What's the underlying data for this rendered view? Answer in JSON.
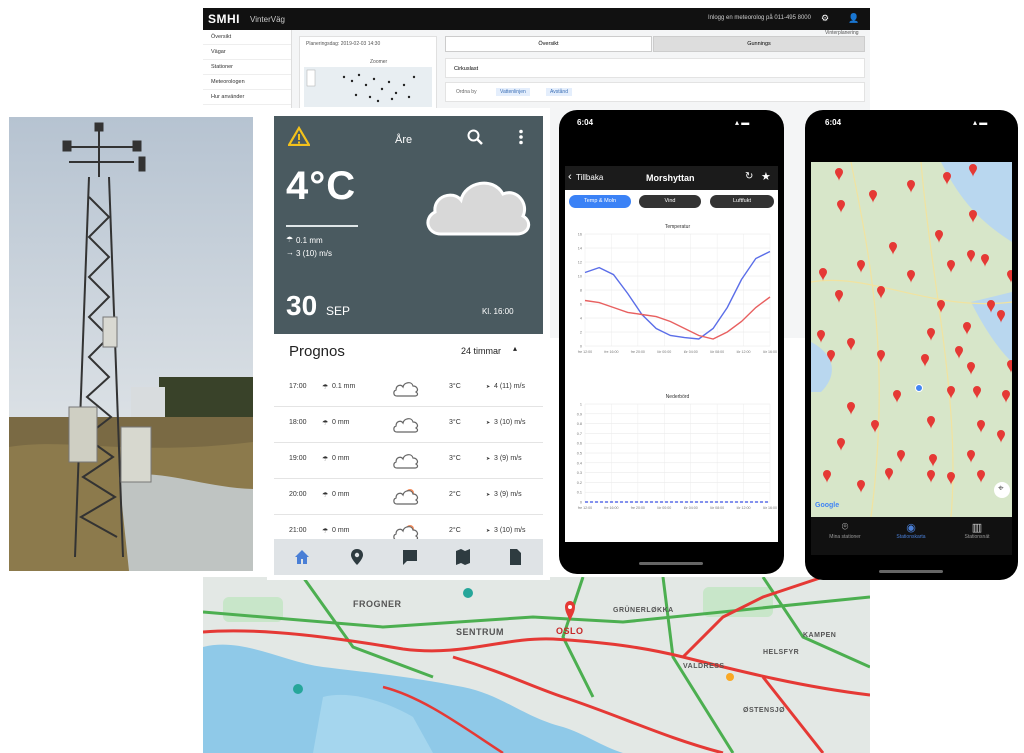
{
  "web": {
    "logo": "SMHI",
    "app_name": "VinterVäg",
    "top_right": "Inlogg en meteorolog på 011-495 8000",
    "sidebar": [
      "Översikt",
      "Vägar",
      "Stationer",
      "Meteorologen",
      "Hur använder"
    ],
    "panel_date": "Planeringsdag: 2019-02-03 14:30",
    "panel_zoom": "Zoomer",
    "tab_left": "Översikt",
    "tab_right": "Gunnings",
    "section": "Cirkuslast",
    "filter_label": "Ordna by",
    "chip_one": "Vattenlinjen",
    "chip_two": "Avstånd",
    "corner_right": "Vinterplanering"
  },
  "android": {
    "location": "Åre",
    "temperature": "4°C",
    "precip": "0.1 mm",
    "wind": "3 (10) m/s",
    "date_day": "30",
    "date_month": "SEP",
    "time": "Kl. 16:00",
    "prognos_title": "Prognos",
    "period": "24 timmar",
    "rows": [
      {
        "time": "17:00",
        "precip": "0.1 mm",
        "temp": "3°C",
        "wind": "4 (11) m/s",
        "sun": false
      },
      {
        "time": "18:00",
        "precip": "0 mm",
        "temp": "3°C",
        "wind": "3 (10) m/s",
        "sun": false
      },
      {
        "time": "19:00",
        "precip": "0 mm",
        "temp": "3°C",
        "wind": "3 (9) m/s",
        "sun": false
      },
      {
        "time": "20:00",
        "precip": "0 mm",
        "temp": "2°C",
        "wind": "3 (9) m/s",
        "sun": true
      },
      {
        "time": "21:00",
        "precip": "0 mm",
        "temp": "2°C",
        "wind": "3 (10) m/s",
        "sun": true
      }
    ]
  },
  "chart_app": {
    "status_time": "6:04",
    "back_label": "Tillbaka",
    "station": "Morshyttan",
    "pills": [
      "Temp & Moln",
      "Vind",
      "Luftfukt"
    ],
    "chart_data": [
      {
        "type": "line",
        "title": "Temperatur",
        "x": [
          "fre 12:00",
          "fre 16:00",
          "fre 20:00",
          "lör 00:00",
          "lör 04:00",
          "lör 08:00",
          "lör 12:00",
          "lör 16:00"
        ],
        "ylim": [
          0,
          16
        ],
        "yticks": [
          0,
          2,
          4,
          6,
          8,
          10,
          12,
          14,
          16
        ],
        "series": [
          {
            "color": "#5b6ee8",
            "values": [
              10.5,
              11.2,
              10.2,
              7.5,
              4.5,
              2.5,
              1.5,
              1.2,
              1.0,
              2.5,
              5.5,
              9.5,
              12.5,
              13.5
            ]
          },
          {
            "color": "#e86060",
            "values": [
              6.5,
              6.2,
              5.5,
              4.8,
              4.5,
              4.2,
              3.5,
              2.5,
              1.5,
              1.0,
              2.0,
              3.5,
              5.5,
              7.0
            ]
          }
        ]
      },
      {
        "type": "line",
        "title": "Nederbörd",
        "x": [
          "fre 12:00",
          "fre 16:00",
          "fre 20:00",
          "lör 00:00",
          "lör 04:00",
          "lör 08:00",
          "lör 12:00",
          "lör 16:00"
        ],
        "ylim": [
          0,
          1.0
        ],
        "yticks": [
          0,
          0.1,
          0.2,
          0.3,
          0.4,
          0.5,
          0.6,
          0.7,
          0.8,
          0.9,
          1.0
        ],
        "series": [
          {
            "color": "#5b6ee8",
            "values": [
              0,
              0,
              0,
              0,
              0,
              0,
              0,
              0,
              0,
              0,
              0,
              0,
              0,
              0
            ]
          }
        ]
      }
    ]
  },
  "map_app": {
    "status_time": "6:04",
    "google": "Google",
    "tabs": [
      "Mina stationer",
      "Stationskarta",
      "Stationsnät"
    ]
  },
  "traffic_map": {
    "labels": [
      "FROGNER",
      "SENTRUM",
      "OSLO",
      "GRÜNERLØKKA",
      "KAMPEN",
      "VALDRESS",
      "HELSFYR",
      "ØSTENSJØ"
    ]
  },
  "colors": {
    "android_header": "#4a5a60",
    "pill_active": "#3b82f6",
    "pin_red": "#e53935",
    "traffic_red": "#e53935",
    "traffic_green": "#4caf50"
  }
}
